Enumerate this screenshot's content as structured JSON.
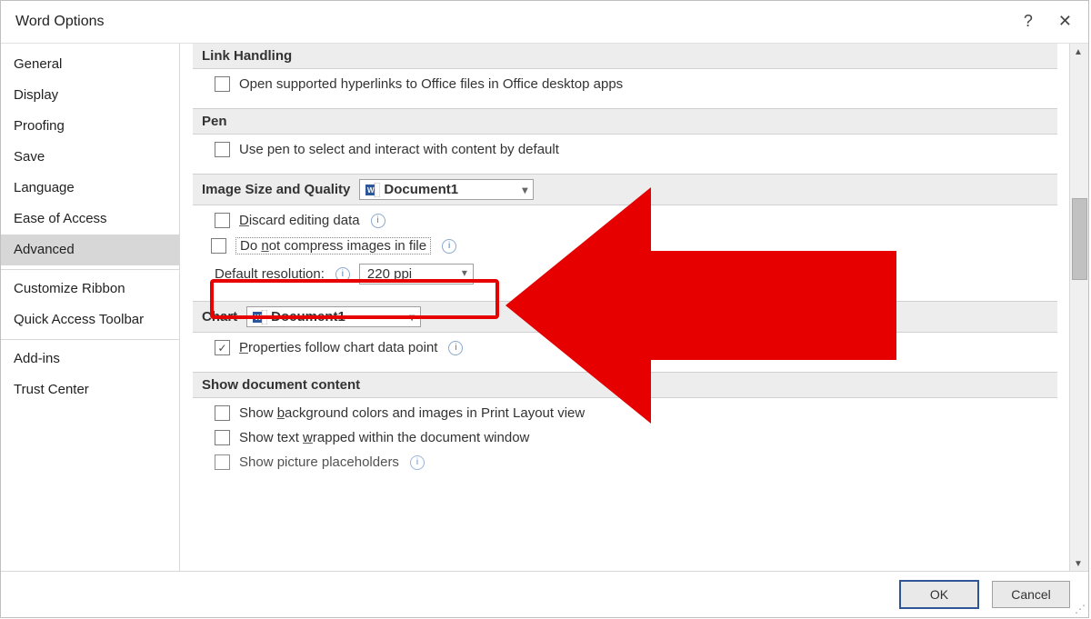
{
  "dialog": {
    "title": "Word Options"
  },
  "sidebar": {
    "items": [
      {
        "label": "General"
      },
      {
        "label": "Display"
      },
      {
        "label": "Proofing"
      },
      {
        "label": "Save"
      },
      {
        "label": "Language"
      },
      {
        "label": "Ease of Access"
      },
      {
        "label": "Advanced",
        "selected": true
      }
    ],
    "group2": [
      {
        "label": "Customize Ribbon"
      },
      {
        "label": "Quick Access Toolbar"
      }
    ],
    "group3": [
      {
        "label": "Add-ins"
      },
      {
        "label": "Trust Center"
      }
    ]
  },
  "sections": {
    "link_handling": {
      "title": "Link Handling",
      "open_in_desktop": "Open supported hyperlinks to Office files in Office desktop apps"
    },
    "pen": {
      "title": "Pen",
      "use_pen": "Use pen to select and interact with content by default"
    },
    "image_quality": {
      "title": "Image Size and Quality",
      "doc_combo": "Document1",
      "discard_label": "iscard editing data",
      "discard_accel": "D",
      "do_not_compress_pre": "Do ",
      "do_not_compress_accel": "n",
      "do_not_compress_post": "ot compress images in file",
      "default_res_pre": "",
      "default_res_accel": "D",
      "default_res_post": "efault resolution:",
      "resolution_value": "220 ppi"
    },
    "chart": {
      "title": "Chart",
      "doc_combo": "Document1",
      "follow_pre": "",
      "follow_accel": "P",
      "follow_post": "roperties follow chart data point"
    },
    "show_doc": {
      "title": "Show document content",
      "bg_pre": "Show ",
      "bg_accel": "b",
      "bg_post": "ackground colors and images in Print Layout view",
      "wrap_pre": "Show text ",
      "wrap_accel": "w",
      "wrap_post": "rapped within the document window",
      "pic_label": "Show picture placeholders"
    }
  },
  "footer": {
    "ok": "OK",
    "cancel": "Cancel"
  }
}
